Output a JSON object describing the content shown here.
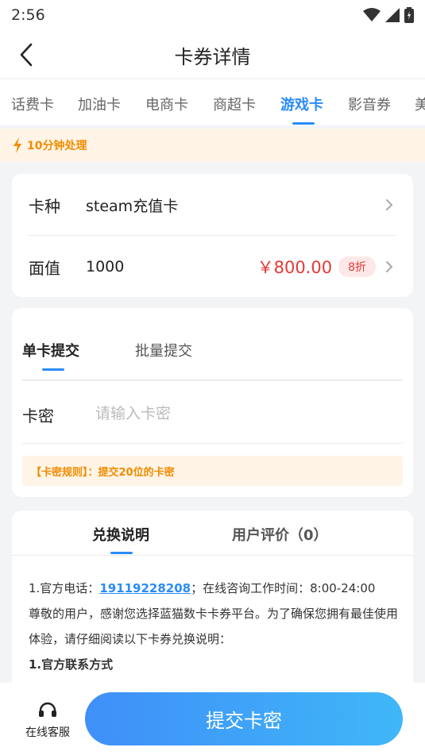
{
  "status_bar": {
    "time": "2:56"
  },
  "nav": {
    "title": "卡券详情"
  },
  "category_tabs": [
    {
      "label": "话费卡",
      "active": false
    },
    {
      "label": "加油卡",
      "active": false
    },
    {
      "label": "电商卡",
      "active": false
    },
    {
      "label": "商超卡",
      "active": false
    },
    {
      "label": "游戏卡",
      "active": true
    },
    {
      "label": "影音券",
      "active": false
    },
    {
      "label": "美",
      "active": false
    }
  ],
  "notice": {
    "text": "10分钟处理"
  },
  "card_info": {
    "type_label": "卡种",
    "type_value": "steam充值卡",
    "face_label": "面值",
    "face_value": "1000",
    "price": "￥800.00",
    "discount": "8折"
  },
  "submit_section": {
    "tabs": [
      "单卡提交",
      "批量提交"
    ],
    "pin_label": "卡密",
    "pin_placeholder": "请输入卡密",
    "rule_text": "【卡密规则】：提交20位的卡密"
  },
  "info_section": {
    "tabs": [
      "兑换说明",
      "用户评价（0）"
    ],
    "line1_prefix": "1.官方电话：",
    "phone": "19119228208",
    "line1_suffix": "；在线咨询工作时间：8:00-24:00",
    "line2": "尊敬的用户，感谢您选择蓝猫数卡卡券平台。为了确保您拥有最佳使用体验，请仔细阅读以下卡券兑换说明：",
    "heading": "1.官方联系方式"
  },
  "bottom_bar": {
    "cs_label": "在线客服",
    "submit_label": "提交卡密"
  },
  "colors": {
    "accent": "#2a8cf7",
    "price": "#e53935",
    "notice": "#f08c00"
  }
}
